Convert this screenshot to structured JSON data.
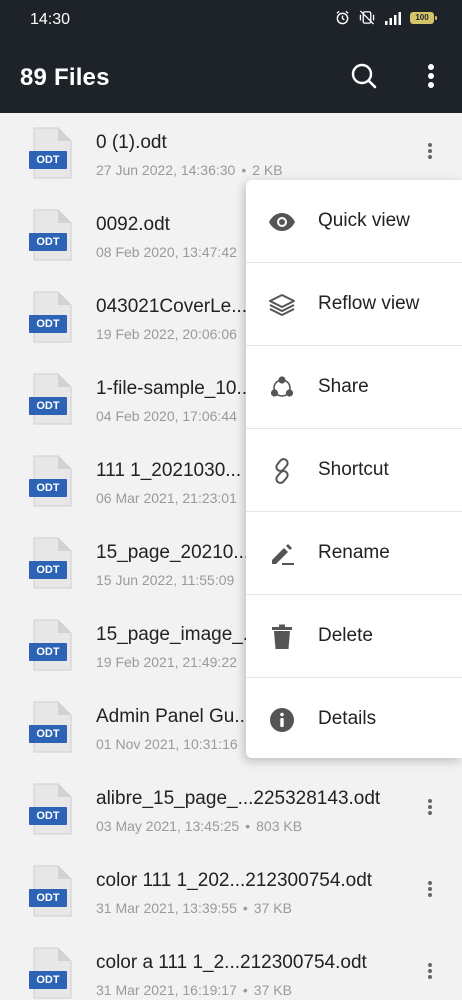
{
  "status_bar": {
    "time": "14:30",
    "battery": "100"
  },
  "app_bar": {
    "title": "89 Files"
  },
  "files": [
    {
      "badge": "ODT",
      "name": "0 (1).odt",
      "date": "27 Jun 2022, 14:36:30",
      "size": "2 KB"
    },
    {
      "badge": "ODT",
      "name": "0092.odt",
      "date": "08 Feb 2020, 13:47:42",
      "size": ""
    },
    {
      "badge": "ODT",
      "name": "043021CoverLe...",
      "date": "19 Feb 2022, 20:06:06",
      "size": ""
    },
    {
      "badge": "ODT",
      "name": "1-file-sample_10...",
      "date": "04 Feb 2020, 17:06:44",
      "size": ""
    },
    {
      "badge": "ODT",
      "name": "111 1_2021030...",
      "date": "06 Mar 2021, 21:23:01",
      "size": ""
    },
    {
      "badge": "ODT",
      "name": "15_page_20210...",
      "date": "15 Jun 2022, 11:55:09",
      "size": ""
    },
    {
      "badge": "ODT",
      "name": "15_page_image_...",
      "date": "19 Feb 2021, 21:49:22",
      "size": ""
    },
    {
      "badge": "ODT",
      "name": "Admin Panel Gu...",
      "date": "01 Nov 2021, 10:31:16",
      "size": ""
    },
    {
      "badge": "ODT",
      "name": "alibre_15_page_...225328143.odt",
      "date": "03 May 2021, 13:45:25",
      "size": "803 KB"
    },
    {
      "badge": "ODT",
      "name": "color 111 1_202...212300754.odt",
      "date": "31 Mar 2021, 13:39:55",
      "size": "37 KB"
    },
    {
      "badge": "ODT",
      "name": "color a 111 1_2...212300754.odt",
      "date": "31 Mar 2021, 16:19:17",
      "size": "37 KB"
    }
  ],
  "context_menu": {
    "items": [
      {
        "label": "Quick view",
        "icon": "eye-icon"
      },
      {
        "label": "Reflow view",
        "icon": "layers-icon"
      },
      {
        "label": "Share",
        "icon": "share-icon"
      },
      {
        "label": "Shortcut",
        "icon": "link-icon"
      },
      {
        "label": "Rename",
        "icon": "pencil-icon"
      },
      {
        "label": "Delete",
        "icon": "trash-icon"
      },
      {
        "label": "Details",
        "icon": "info-icon"
      }
    ]
  }
}
